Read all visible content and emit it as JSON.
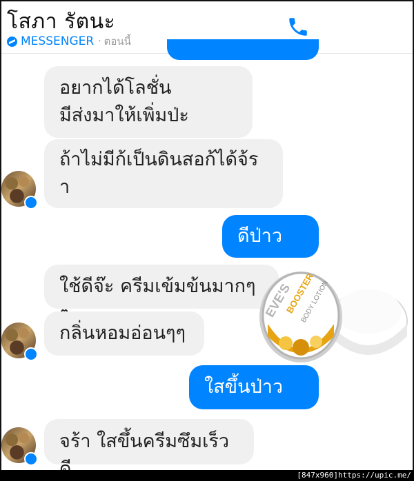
{
  "header": {
    "contact_name": "โสภา รัตนะ",
    "app_label": "MESSENGER",
    "separator": "·",
    "time": "ตอนนี้"
  },
  "messages": [
    {
      "from": "them",
      "text": "อยากได้โลชั่น\nมีส่งมาให้เพิ่มป่ะ"
    },
    {
      "from": "them",
      "text": "ถ้าไม่มีก้เป็นดินสอก้ได้จ้ร\nา"
    },
    {
      "from": "me",
      "text": "ดีป่าวคะ"
    },
    {
      "from": "them",
      "text": "ใช้ดีจ๊ะ ครีมเข้มข้นมากๆๆ"
    },
    {
      "from": "them",
      "text": "กลิ่นหอมอ่อนๆๆ"
    },
    {
      "from": "me",
      "text": "ใสขึ้นป่าวคะ"
    },
    {
      "from": "them",
      "text": "จร้า ใสขึ้นครีมซึมเร็วดี"
    }
  ],
  "product": {
    "brand": "EVE'S",
    "line": "BOOSTER",
    "type": "BODY LOTION",
    "colors": {
      "gold": "#e6a312",
      "cream": "#f4f4f4"
    }
  },
  "watermark": "[847x960]https://upic.me/",
  "colors": {
    "accent": "#0084ff",
    "incoming_bubble": "#f1f0f0"
  },
  "icons": {
    "call": "phone-icon",
    "messenger": "messenger-icon"
  }
}
